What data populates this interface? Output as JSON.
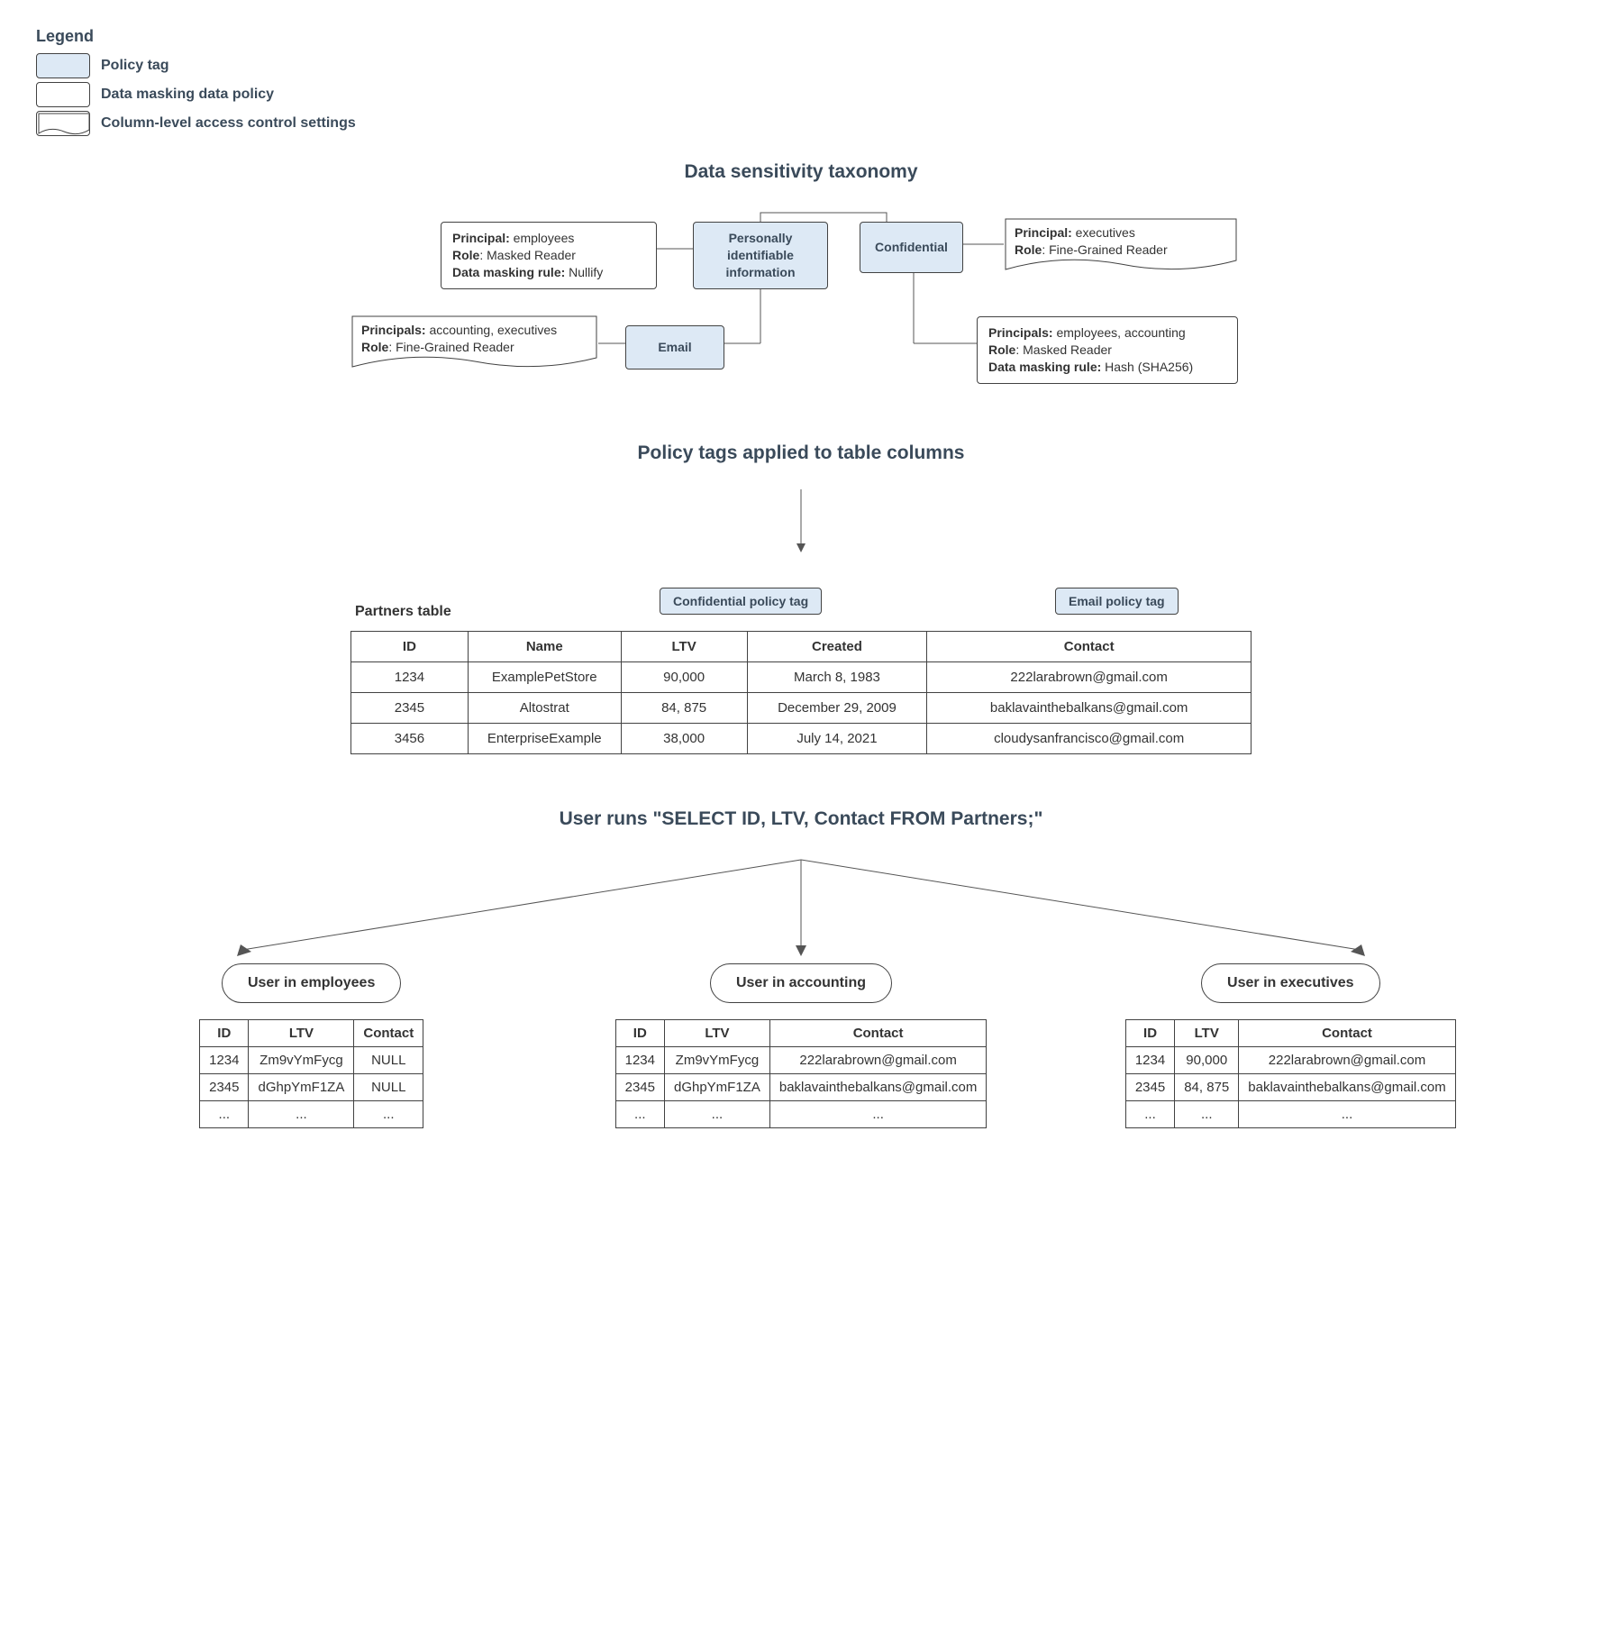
{
  "legend": {
    "title": "Legend",
    "items": [
      {
        "label": "Policy tag"
      },
      {
        "label": "Data masking data policy"
      },
      {
        "label": "Column-level access control settings"
      }
    ]
  },
  "sections": {
    "taxonomy": "Data sensitivity taxonomy",
    "applied": "Policy tags applied to table columns",
    "query": "User runs \"SELECT ID, LTV, Contact FROM Partners;\""
  },
  "taxonomy": {
    "pii_tag": "Personally identifiable information",
    "confidential_tag": "Confidential",
    "email_tag": "Email",
    "pii_policy": {
      "principal_label": "Principal:",
      "principal": " employees",
      "role_label": "Role",
      "role": ": Masked Reader",
      "rule_label": "Data masking rule:",
      "rule": " Nullify"
    },
    "confidential_acl": {
      "principal_label": "Principal:",
      "principal": " executives",
      "role_label": "Role",
      "role": ": Fine-Grained Reader"
    },
    "email_acl": {
      "principal_label": "Principals:",
      "principal": " accounting, executives",
      "role_label": "Role",
      "role": ": Fine-Grained Reader"
    },
    "confidential_policy": {
      "principal_label": "Principals:",
      "principal": " employees, accounting",
      "role_label": "Role",
      "role": ": Masked Reader",
      "rule_label": "Data masking rule:",
      "rule": " Hash (SHA256)"
    }
  },
  "tag_chips": {
    "confidential": "Confidential policy tag",
    "email": "Email policy tag"
  },
  "partners": {
    "title": "Partners table",
    "headers": [
      "ID",
      "Name",
      "LTV",
      "Created",
      "Contact"
    ],
    "rows": [
      [
        "1234",
        "ExamplePetStore",
        "90,000",
        "March 8, 1983",
        "222larabrown@gmail.com"
      ],
      [
        "2345",
        "Altostrat",
        "84, 875",
        "December 29, 2009",
        "baklavainthebalkans@gmail.com"
      ],
      [
        "3456",
        "EnterpriseExample",
        "38,000",
        "July 14, 2021",
        "cloudysanfrancisco@gmail.com"
      ]
    ]
  },
  "results": {
    "roles": [
      "User in employees",
      "User in accounting",
      "User in executives"
    ],
    "headers": [
      "ID",
      "LTV",
      "Contact"
    ],
    "employees": [
      [
        "1234",
        "Zm9vYmFycg",
        "NULL"
      ],
      [
        "2345",
        "dGhpYmF1ZA",
        "NULL"
      ],
      [
        "...",
        "...",
        "..."
      ]
    ],
    "accounting": [
      [
        "1234",
        "Zm9vYmFycg",
        "222larabrown@gmail.com"
      ],
      [
        "2345",
        "dGhpYmF1ZA",
        "baklavainthebalkans@gmail.com"
      ],
      [
        "...",
        "...",
        "..."
      ]
    ],
    "executives": [
      [
        "1234",
        "90,000",
        "222larabrown@gmail.com"
      ],
      [
        "2345",
        "84, 875",
        "baklavainthebalkans@gmail.com"
      ],
      [
        "...",
        "...",
        "..."
      ]
    ]
  }
}
